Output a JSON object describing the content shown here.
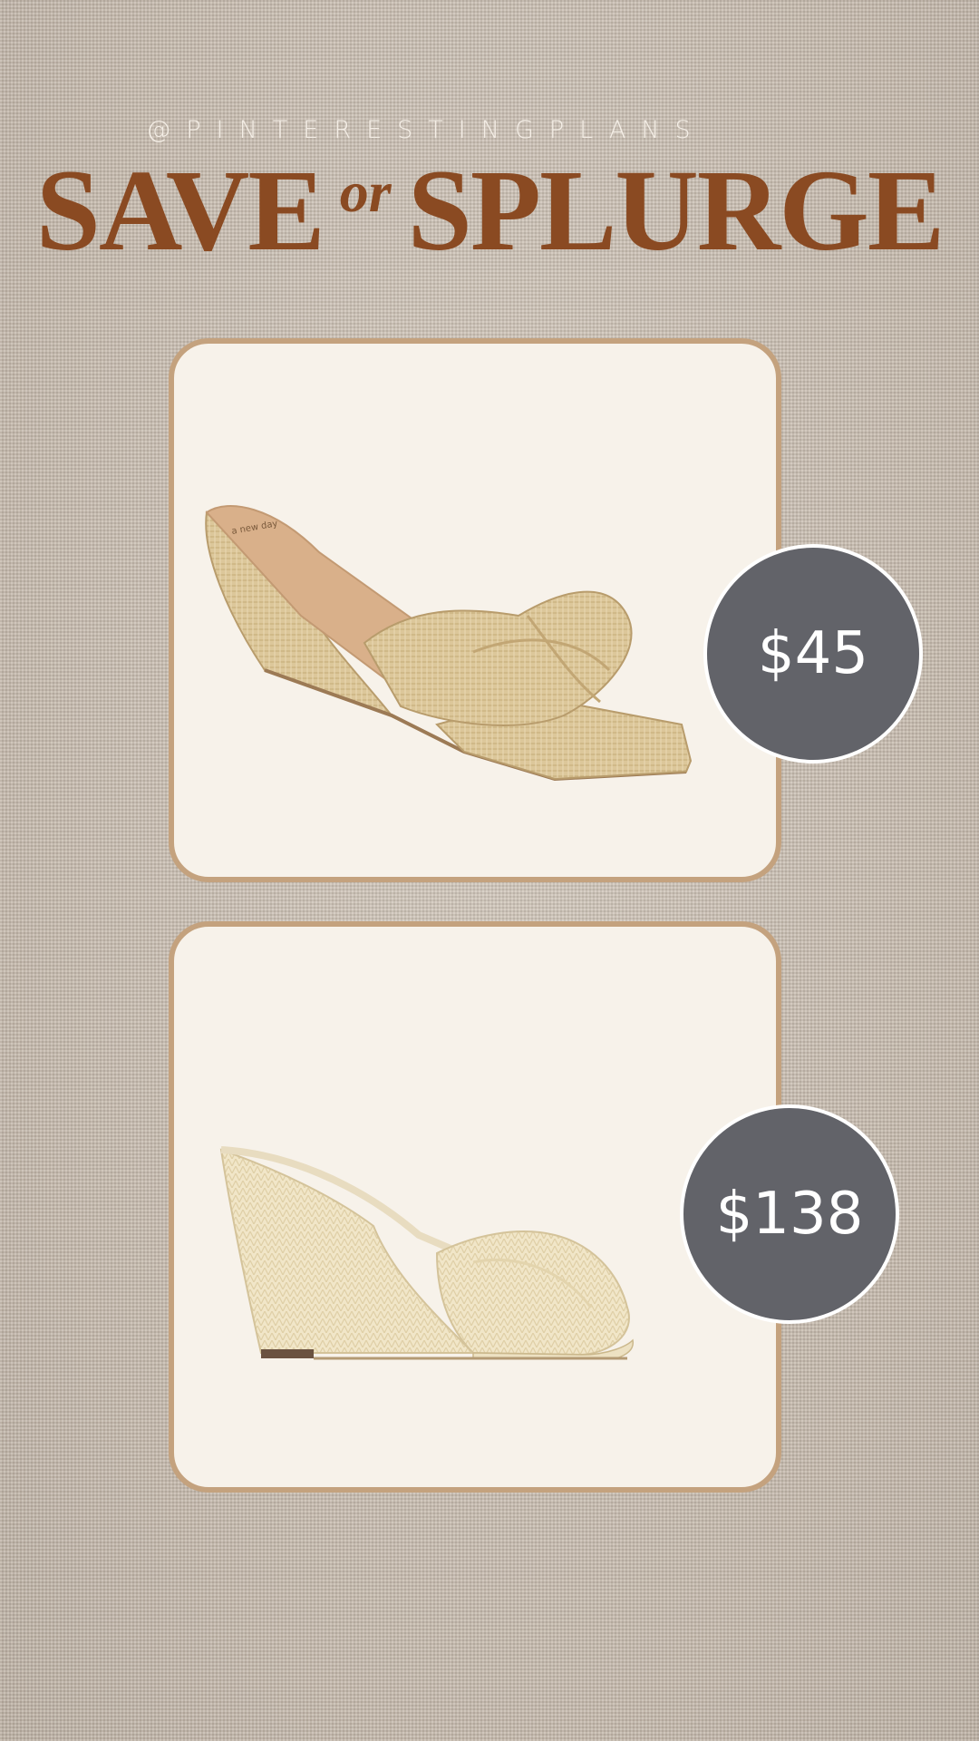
{
  "header": {
    "handle": "@PINTERESTINGPLANS",
    "title_save": "SAVE",
    "title_or": "or",
    "title_splurge": "SPLURGE"
  },
  "products": [
    {
      "price": "$45",
      "description": "raffia knotted wedge sandal (save)"
    },
    {
      "price": "$138",
      "description": "cream woven knotted wedge sandal (splurge)"
    }
  ],
  "colors": {
    "title": "#8a4a22",
    "card_border": "#c4a27e",
    "card_bg": "#f7f2ea",
    "price_badge": "#626369"
  }
}
